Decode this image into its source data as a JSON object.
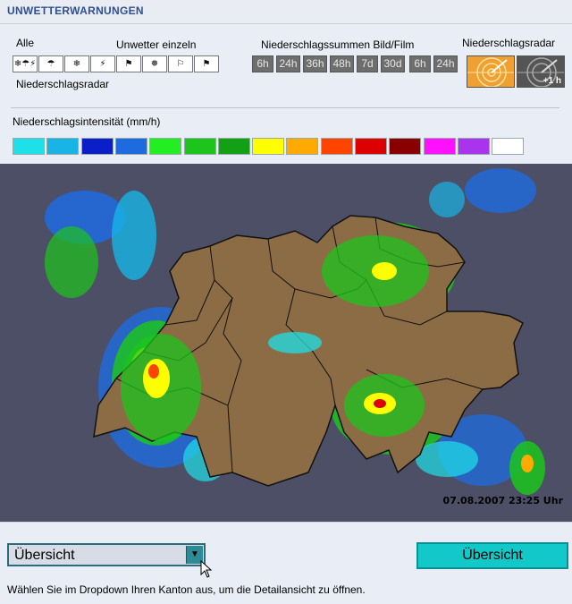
{
  "window": {
    "title": "UNWETTERWARNUNGEN"
  },
  "controls": {
    "alle_label": "Alle",
    "einzeln_label": "Unwetter einzeln",
    "summen_label": "Niederschlagssummen Bild/Film",
    "radar_label": "Niederschlagsradar",
    "radar_sub_label": "Niederschlagsradar",
    "icons": [
      {
        "name": "all-warnings-icon",
        "glyph": "❄☂⚡"
      },
      {
        "name": "rain-icon",
        "glyph": "☂"
      },
      {
        "name": "snow-icon",
        "glyph": "❄"
      },
      {
        "name": "thunderstorm-icon",
        "glyph": "⚡"
      },
      {
        "name": "wind-icon",
        "glyph": "⚑"
      },
      {
        "name": "frost-icon",
        "glyph": "❅"
      },
      {
        "name": "flag-icon",
        "glyph": "⚐"
      },
      {
        "name": "storm-flag-icon",
        "glyph": "⚑"
      }
    ],
    "sum_buttons": [
      "6h",
      "24h",
      "36h",
      "48h",
      "7d",
      "30d"
    ],
    "film_buttons": [
      "6h",
      "24h"
    ],
    "radar_plus_label": "+1 h"
  },
  "legend": {
    "title": "Niederschlagsintensität (mm/h)",
    "colors": [
      "#1ee0e8",
      "#18b4e6",
      "#0a1fc8",
      "#1e6be0",
      "#22ee22",
      "#1cc41c",
      "#14a014",
      "#ffff00",
      "#ffaa00",
      "#ff4400",
      "#dd0000",
      "#8a0000",
      "#ff10ff",
      "#aa33ee",
      "#ffffff"
    ]
  },
  "map": {
    "timestamp": "07.08.2007 23:25 Uhr"
  },
  "footer": {
    "dropdown_value": "Übersicht",
    "button_label": "Übersicht",
    "hint": "Wählen Sie im Dropdown Ihren Kanton aus, um die Detailansicht zu öffnen."
  }
}
